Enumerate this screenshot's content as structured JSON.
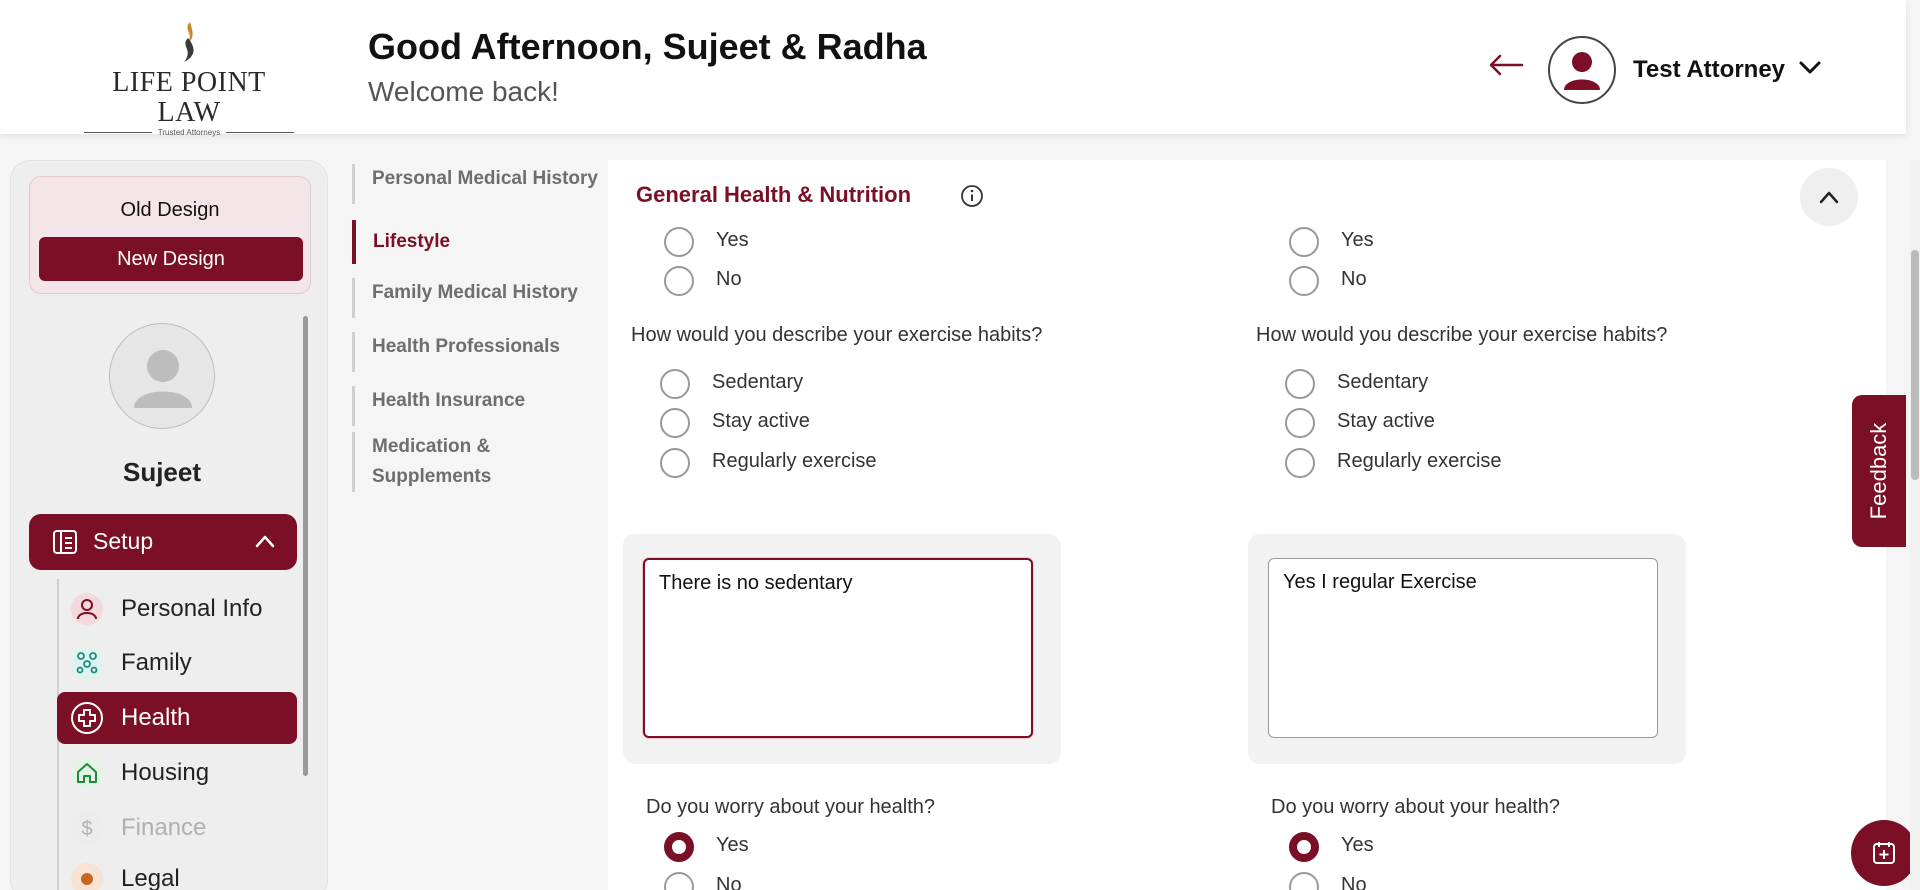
{
  "header": {
    "logo_name": "LIFE POINT LAW",
    "logo_tagline": "Trusted Attorneys",
    "greeting": "Good Afternoon, Sujeet & Radha",
    "welcome": "Welcome back!",
    "user_name": "Test Attorney"
  },
  "sidebar": {
    "old_design": "Old Design",
    "new_design": "New Design",
    "profile_name": "Sujeet",
    "setup_label": "Setup",
    "items": [
      {
        "label": "Personal Info",
        "icon": "person-icon"
      },
      {
        "label": "Family",
        "icon": "family-icon"
      },
      {
        "label": "Health",
        "icon": "health-plus-icon",
        "active": true
      },
      {
        "label": "Housing",
        "icon": "home-icon"
      },
      {
        "label": "Finance",
        "icon": "dollar-icon",
        "disabled": true
      },
      {
        "label": "Legal",
        "icon": "legal-icon"
      }
    ]
  },
  "subnav": {
    "items": [
      {
        "label": "Personal Medical History"
      },
      {
        "label": "Lifestyle",
        "active": true
      },
      {
        "label": "Family Medical History"
      },
      {
        "label": "Health Professionals"
      },
      {
        "label": "Health Insurance"
      },
      {
        "label": "Medication &"
      },
      {
        "label": "Supplements"
      }
    ]
  },
  "main": {
    "section_title": "General Health & Nutrition",
    "columns": [
      {
        "prev_options": [
          "Yes",
          "No"
        ],
        "exercise_question": "How would you describe your exercise habits?",
        "exercise_options": [
          "Sedentary",
          "Stay active",
          "Regularly exercise"
        ],
        "notes_value": "There is no sedentary",
        "worry_question": "Do you worry about your health?",
        "worry_options": [
          "Yes",
          "No"
        ],
        "worry_selected": "Yes"
      },
      {
        "prev_options": [
          "Yes",
          "No"
        ],
        "exercise_question": "How would you describe your exercise habits?",
        "exercise_options": [
          "Sedentary",
          "Stay active",
          "Regularly exercise"
        ],
        "notes_value": "Yes I regular Exercise",
        "worry_question": "Do you worry about your health?",
        "worry_options": [
          "Yes",
          "No"
        ],
        "worry_selected": "Yes"
      }
    ]
  },
  "feedback_label": "Feedback",
  "colors": {
    "brand": "#7a0f25",
    "background": "#f5f5f5"
  }
}
